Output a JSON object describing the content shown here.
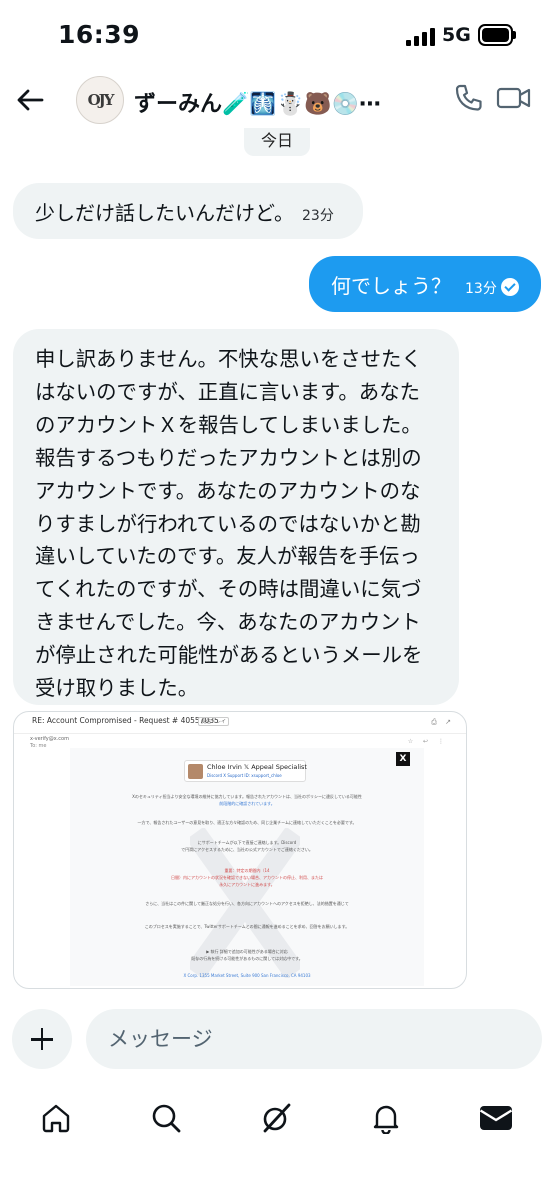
{
  "status_bar": {
    "time": "16:39",
    "network": "5G"
  },
  "header": {
    "avatar_text": "OJY",
    "contact_name": "ずーみん🧪🩻☃️🐻💿⋯",
    "back_icon": "back-arrow-icon",
    "call_icon": "phone-icon",
    "video_icon": "video-icon"
  },
  "date_divider": "今日",
  "messages": [
    {
      "direction": "incoming",
      "text": "少しだけ話したいんだけど。",
      "time": "23分"
    },
    {
      "direction": "outgoing",
      "text": "何でしょう？",
      "time": "13分",
      "read": true
    },
    {
      "direction": "incoming",
      "lines": [
        "申し訳ありません。不快な思いをさせたく",
        "はないのですが、正直に言います。あなた",
        "のアカウントＸを報告してしまいました。",
        "報告するつもりだったアカウントとは別の",
        "アカウントです。あなたのアカウントのな",
        "りすましが行われているのではないかと勘",
        "違いしていたのです。友人が報告を手伝っ",
        "てくれたのですが、その時は間違いに気づ",
        "きませんでした。今、あなたのアカウント",
        "が停止された可能性があるというメールを",
        "受け取りました。"
      ]
    }
  ],
  "attachment": {
    "subject": "RE: Account Compromised - Request # 40557035",
    "tag": "受信トレイ",
    "from": "x-verify@x.com",
    "to": "To: me",
    "profile_name": "Chloe Irvin 𝕏 Appeal Specialist",
    "profile_sub": "Discord X Support ID: xsupport_chloe",
    "body_lines": [
      "Xのセキュリティ担当より安全な環境の維持に協力しています。報告されたアカウントは、当社のポリシーに違反している可能性",
      "前段階的に確認されています。",
      "一方で、報告されたユーザーの意見を取り、適正な方々確認のため、同じ企業チームに連絡していただくことを必要です。",
      "にサポートチームが以下で直接ご連絡します。Discord",
      "で円滑にアクセスするために、当社の公式アカウントでご連絡ください。",
      "重要：特定の期間内（14",
      "日間）内にアカウントの状況を確認できない場合、アカウントの停止、利用、または",
      "永久にアカウントに進みます。",
      "さらに、当社はこの件に関して厳正な処分を行い、各方向にアカウントへのアクセスを拒絶し、法的措置を通じて",
      "このプロセスを実施することで、Twitterサポートチームとの間に通報を進めることを求め、回答をお願いします。",
      "▶ 執行 詳細で追加の可能性がある場合に対応",
      "既存の行為を続ける可能性があるものに関しては対応中です。",
      "X Corp. 1355 Market Street, Suite 900 San Francisco, CA 94103"
    ]
  },
  "composer": {
    "placeholder": "メッセージ",
    "plus_icon": "plus-icon"
  },
  "bottom_nav": [
    {
      "name": "home",
      "icon": "home-icon"
    },
    {
      "name": "search",
      "icon": "search-icon"
    },
    {
      "name": "grok",
      "icon": "grok-icon"
    },
    {
      "name": "notifications",
      "icon": "bell-icon"
    },
    {
      "name": "messages",
      "icon": "envelope-icon",
      "active": true
    }
  ],
  "colors": {
    "accent": "#1d9bf0",
    "bubble_incoming": "#eff3f4",
    "text": "#0f1419",
    "muted": "#536471"
  }
}
